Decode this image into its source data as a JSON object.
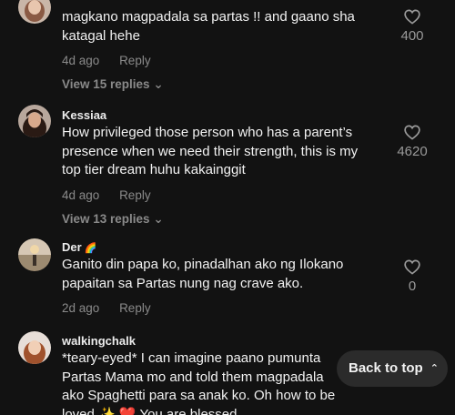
{
  "comments": [
    {
      "username": "",
      "text": "magkano magpadala sa partas !! and gaano sha katagal hehe",
      "age": "4d ago",
      "reply_label": "Reply",
      "replies_label": "View 15 replies",
      "likes": "400"
    },
    {
      "username": "Kessiaa",
      "text": "How privileged those person who has a parent’s presence when we need their strength, this is my top tier dream huhu kakainggit",
      "age": "4d ago",
      "reply_label": "Reply",
      "replies_label": "View 13 replies",
      "likes": "4620"
    },
    {
      "username": "Der",
      "username_emoji": "🌈",
      "text": "Ganito din papa ko, pinadalhan ako ng Ilokano papaitan sa Partas nung nag crave ako.",
      "age": "2d ago",
      "reply_label": "Reply",
      "likes": "0"
    },
    {
      "username": "walkingchalk",
      "text": "*teary-eyed* I can imagine paano pumunta Partas Mama mo and told them magpadala ako Spaghetti para sa anak ko. Oh how to be loved ✨ ❤️ You are blessed"
    }
  ],
  "back_to_top": "Back to top",
  "back_to_top_icon": "double-chevron-up-icon",
  "like_icon": "heart-outline-icon",
  "colors": {
    "background": "#121212",
    "text": "#f2f2f2",
    "muted": "#8a8a8a",
    "button_bg": "#2b2b2b"
  }
}
